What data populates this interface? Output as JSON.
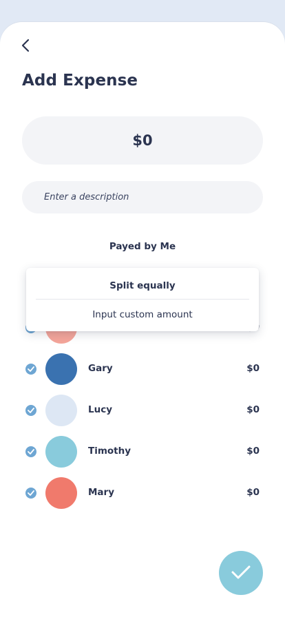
{
  "screen": {
    "title": "Add Expense",
    "amount": "$0",
    "description_placeholder": "Enter a description",
    "payed_by": "Payed by Me"
  },
  "split_menu": {
    "options": [
      "Split equally",
      "Input custom amount"
    ],
    "selected": "Split equally"
  },
  "participants": [
    {
      "name": "",
      "amount": "$0",
      "checked": true,
      "avatar_color": "#f4a59a"
    },
    {
      "name": "Gary",
      "amount": "$0",
      "checked": true,
      "avatar_color": "#3a72b0"
    },
    {
      "name": "Lucy",
      "amount": "$0",
      "checked": true,
      "avatar_color": "#dde7f4"
    },
    {
      "name": "Timothy",
      "amount": "$0",
      "checked": true,
      "avatar_color": "#89cbdc"
    },
    {
      "name": "Mary",
      "amount": "$0",
      "checked": true,
      "avatar_color": "#f07a6c"
    }
  ],
  "colors": {
    "background": "#e1e9f5",
    "primary_text": "#2b3450",
    "field_bg": "#f3f4f7",
    "check": "#6ea6d3",
    "confirm_button": "#89cbdc"
  },
  "icons": {
    "back": "chevron-left-icon",
    "check": "checkmark-icon",
    "confirm": "checkmark-icon"
  }
}
